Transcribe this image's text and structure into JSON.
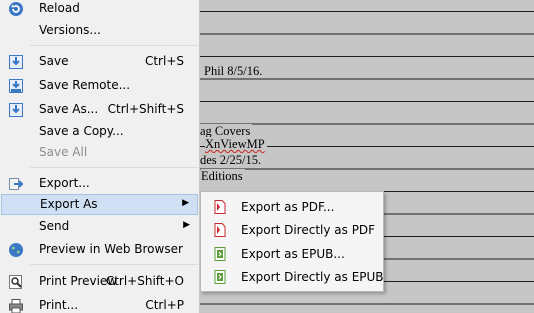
{
  "document": {
    "lines": [
      "Phil 8/5/16.",
      "ag Covers",
      "XnViewMP",
      "des 2/25/15.",
      "Editions"
    ]
  },
  "file_menu": {
    "items": [
      {
        "label": "Reload",
        "shortcut": "",
        "icon": "reload-icon"
      },
      {
        "label": "Versions...",
        "shortcut": ""
      },
      {
        "label": "Save",
        "shortcut": "Ctrl+S",
        "icon": "save-icon"
      },
      {
        "label": "Save Remote...",
        "shortcut": "",
        "icon": "save-remote-icon"
      },
      {
        "label": "Save As...",
        "shortcut": "Ctrl+Shift+S",
        "icon": "save-as-icon"
      },
      {
        "label": "Save a Copy...",
        "shortcut": ""
      },
      {
        "label": "Save All",
        "shortcut": "",
        "disabled": true
      },
      {
        "label": "Export...",
        "shortcut": "",
        "icon": "export-icon"
      },
      {
        "label": "Export As",
        "shortcut": "",
        "submenu": true
      },
      {
        "label": "Send",
        "shortcut": "",
        "submenu": true
      },
      {
        "label": "Preview in Web Browser",
        "shortcut": "",
        "icon": "globe-icon"
      },
      {
        "label": "Print Preview",
        "shortcut": "Ctrl+Shift+O",
        "icon": "print-preview-icon"
      },
      {
        "label": "Print...",
        "shortcut": "Ctrl+P",
        "icon": "printer-icon"
      }
    ]
  },
  "export_as_submenu": {
    "items": [
      {
        "label": "Export as PDF...",
        "icon": "pdf-icon"
      },
      {
        "label": "Export Directly as PDF",
        "icon": "pdf-icon"
      },
      {
        "label": "Export as EPUB...",
        "icon": "epub-icon"
      },
      {
        "label": "Export Directly as EPUB",
        "icon": "epub-icon"
      }
    ]
  },
  "colors": {
    "menu_bg": "#f0f0f0",
    "highlight": "#cfe0f4",
    "pdf_red": "#c8282d",
    "epub_green": "#5d9b3c",
    "save_blue": "#3a78c6"
  }
}
